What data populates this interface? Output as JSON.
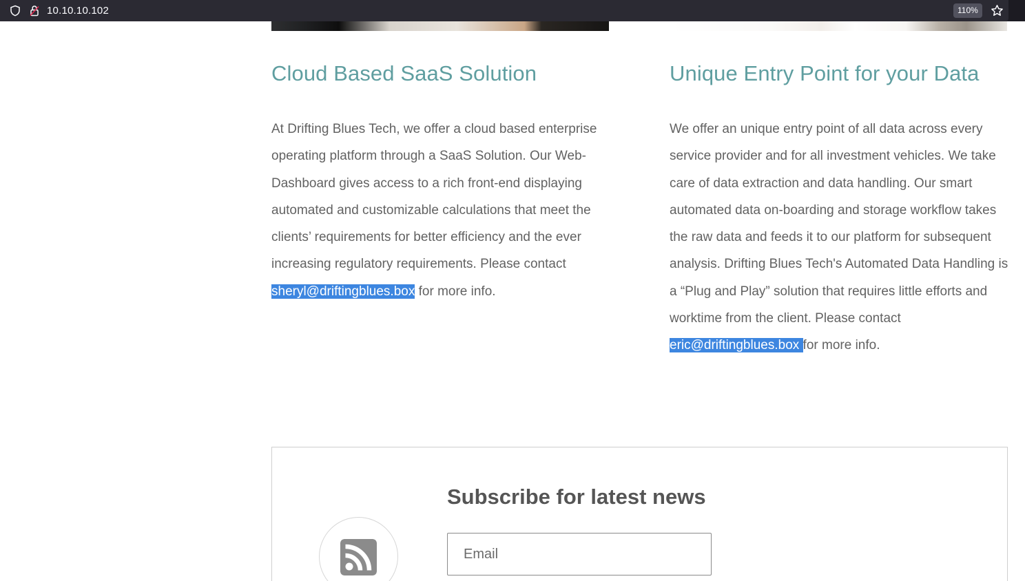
{
  "browser": {
    "url": "10.10.10.102",
    "zoom": "110%"
  },
  "columns": [
    {
      "title": "Cloud Based SaaS Solution",
      "body": "At Drifting Blues Tech, we offer a cloud based enterprise operating platform through a SaaS Solution. Our Web-Dashboard gives access to a rich front-end displaying automated and customizable calculations that meet the clients’ requirements for better efficiency and the ever increasing regulatory requirements. Please contact",
      "email": "sheryl@driftingblues.box",
      "suffix": " for more info."
    },
    {
      "title": "Unique Entry Point for your Data",
      "body": "We offer an unique entry point of all data across every service provider and for all investment vehicles. We take care of data extraction and data handling. Our smart automated data on-boarding and storage workflow takes the raw data and feeds it to our platform for subsequent analysis. Drifting Blues Tech's Automated Data Handling is a “Plug and Play” solution that requires little efforts and worktime from the client. Please contact",
      "email": "eric@driftingblues.box ",
      "suffix": "for more info."
    }
  ],
  "subscribe": {
    "title": "Subscribe for latest news",
    "email_placeholder": "Email"
  },
  "icons": {
    "shield": "shield-icon",
    "lock": "insecure-lock-icon",
    "star": "bookmark-star-icon",
    "rss": "rss-icon"
  }
}
